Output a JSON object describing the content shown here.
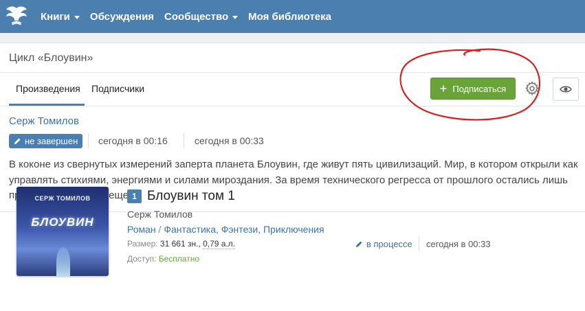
{
  "nav": {
    "logo_icon": "winged-book-logo",
    "items": [
      {
        "label": "Книги",
        "dropdown": true
      },
      {
        "label": "Обсуждения",
        "dropdown": false
      },
      {
        "label": "Сообщество",
        "dropdown": true
      },
      {
        "label": "Моя библиотека",
        "dropdown": false
      }
    ]
  },
  "cycle": {
    "title": "Цикл «Блоувин»",
    "tabs": [
      {
        "label": "Произведения",
        "active": true
      },
      {
        "label": "Подписчики",
        "active": false
      }
    ],
    "subscribe_label": "Подписаться",
    "settings_icon": "gear-icon",
    "view_icon": "eye-icon",
    "author": "Серж Томилов",
    "status": "не завершен",
    "created": "сегодня в 00:16",
    "updated": "сегодня в 00:33",
    "description": "В коконе из свернутых измерений заперта планета Блоувин, где живут пять цивилизаций. Мир, в котором открыли как управлять стихиями, энергиями и силами мироздания. За время технического регресса от прошлого остались лишь предания. И кое-что еще."
  },
  "book": {
    "number": "1",
    "title": "Блоувин том 1",
    "author": "Серж Томилов",
    "genre_form": "Роман",
    "genre_sep": " / ",
    "genre_1": "Фантастика",
    "genre_2": "Фэнтези",
    "genre_3": "Приключения",
    "size_label": "Размер:",
    "size_chars": "31 661 зн.",
    "size_sheets": "0,79 а.л.",
    "access_label": "Доступ:",
    "access_value": "Бесплатно",
    "progress": "в процессе",
    "updated": "сегодня в 00:33",
    "cover_author": "СЕРЖ ТОМИЛОВ",
    "cover_title": "БЛОУВИН"
  },
  "colors": {
    "navbar": "#4a7fb0",
    "link": "#3a73a9",
    "subscribe": "#6aa33a",
    "annotation": "#d81e1e"
  }
}
